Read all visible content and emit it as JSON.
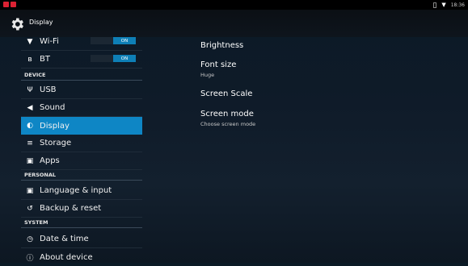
{
  "status_bar": {
    "time": "18:36"
  },
  "action_bar": {
    "title": "Display"
  },
  "sidebar": {
    "wifi": {
      "label": "Wi-Fi",
      "toggle": "ON"
    },
    "bt": {
      "label": "BT",
      "toggle": "ON"
    },
    "device_header": "DEVICE",
    "usb": "USB",
    "sound": "Sound",
    "display": "Display",
    "storage": "Storage",
    "apps": "Apps",
    "personal_header": "PERSONAL",
    "language": "Language & input",
    "backup": "Backup & reset",
    "system_header": "SYSTEM",
    "datetime": "Date & time",
    "about": "About device"
  },
  "content": {
    "brightness": {
      "title": "Brightness"
    },
    "font_size": {
      "title": "Font size",
      "summary": "Huge"
    },
    "screen_scale": {
      "title": "Screen Scale"
    },
    "screen_mode": {
      "title": "Screen mode",
      "summary": "Choose screen mode"
    }
  },
  "colors": {
    "accent": "#0e86c5",
    "background": "#0f1b29"
  }
}
